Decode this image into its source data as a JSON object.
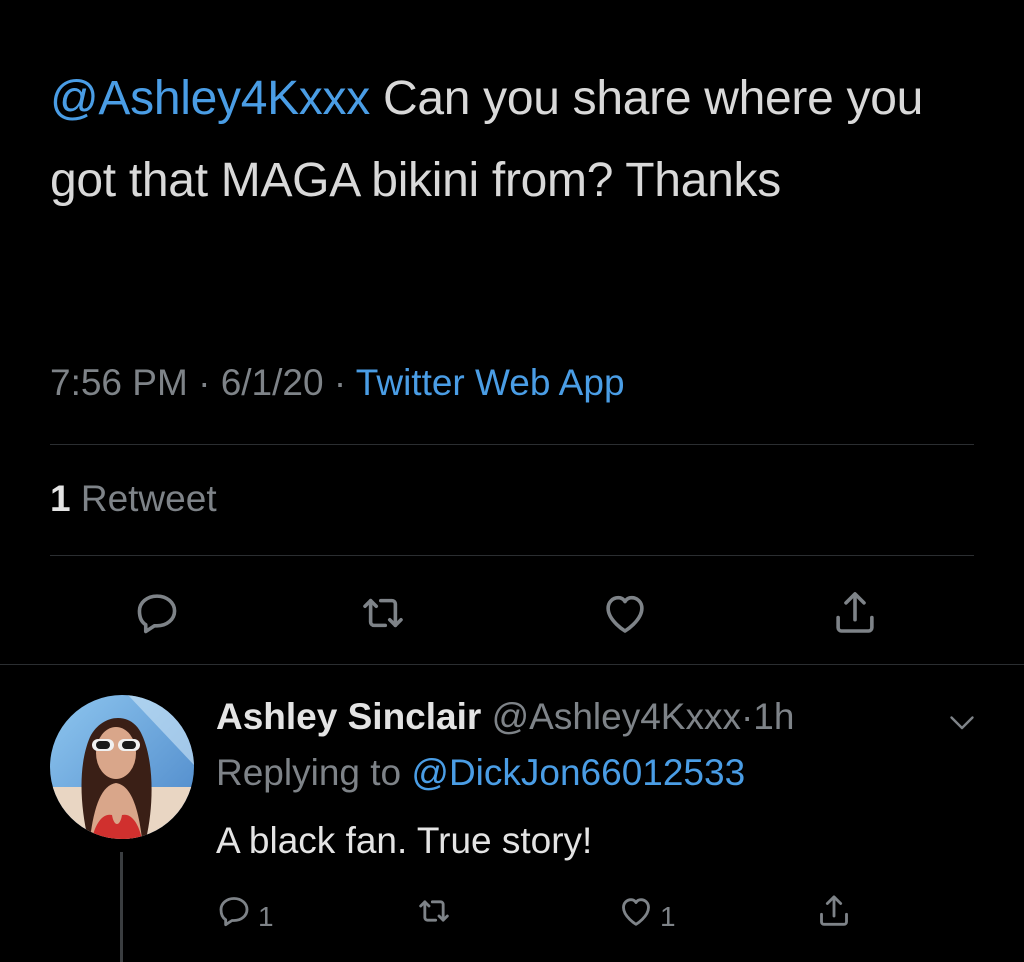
{
  "main_tweet": {
    "mention": "@Ashley4Kxxx",
    "text": " Can you share where you got that MAGA bikini from? Thanks",
    "time": "7:56 PM",
    "date": "6/1/20",
    "separator": "·",
    "source": "Twitter Web App",
    "retweet_count": "1",
    "retweet_label": "Retweet",
    "actions": {
      "reply_icon": "reply-bubble-icon",
      "retweet_icon": "retweet-icon",
      "like_icon": "heart-icon",
      "share_icon": "share-icon"
    }
  },
  "reply": {
    "name": "Ashley Sinclair",
    "handle": "@Ashley4Kxxx",
    "separator": "·",
    "time": "1h",
    "replying_label": "Replying to",
    "replying_to": "@DickJon66012533",
    "text": "A black fan. True story!",
    "reply_count": "1",
    "like_count": "1"
  },
  "colors": {
    "background": "#000000",
    "text": "#d9d9d9",
    "muted": "#7e8388",
    "link": "#4a9de5",
    "divider": "#2b2e31"
  }
}
